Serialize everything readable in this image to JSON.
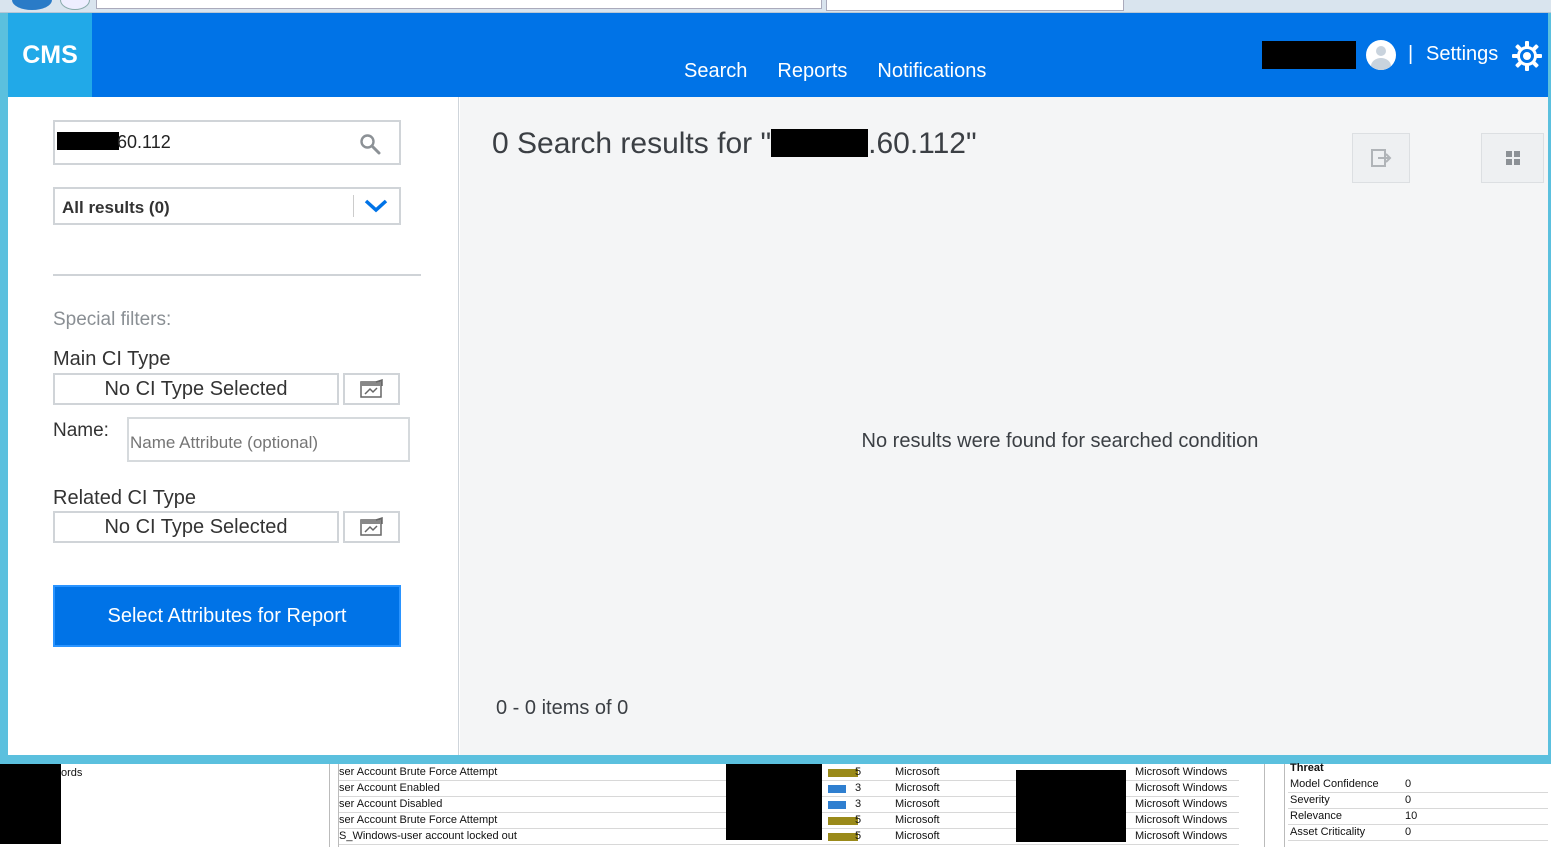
{
  "app": {
    "logo": "CMS"
  },
  "nav": {
    "search": "Search",
    "reports": "Reports",
    "notifications": "Notifications"
  },
  "header": {
    "separator": "|",
    "settings": "Settings"
  },
  "sidebar": {
    "search_value": "60.112",
    "scope": "All results (0)",
    "special_filters": "Special filters:",
    "main_ci_label": "Main CI Type",
    "main_ci_value": "No CI Type Selected",
    "name_label": "Name:",
    "name_placeholder": "Name Attribute (optional)",
    "related_ci_label": "Related CI Type",
    "related_ci_value": "No CI Type Selected",
    "report_button": "Select Attributes for Report"
  },
  "main": {
    "results_prefix": "0 Search results for \"",
    "results_suffix": ".60.112\"",
    "no_results": "No results were found for searched condition",
    "pager": "0 - 0 items of 0"
  },
  "background_window": {
    "left_text": "ords",
    "rows": [
      {
        "name": "ser Account Brute Force Attempt",
        "count": "5",
        "vendor": "Microsoft",
        "product": "Microsoft Windows",
        "color": "#9a8a1a"
      },
      {
        "name": "ser Account Enabled",
        "count": "3",
        "vendor": "Microsoft",
        "product": "Microsoft Windows",
        "color": "#2f7fd0"
      },
      {
        "name": "ser Account Disabled",
        "count": "3",
        "vendor": "Microsoft",
        "product": "Microsoft Windows",
        "color": "#2f7fd0"
      },
      {
        "name": "ser Account Brute Force Attempt",
        "count": "5",
        "vendor": "Microsoft",
        "product": "Microsoft Windows",
        "color": "#9a8a1a"
      },
      {
        "name": "S_Windows-user account locked out",
        "count": "5",
        "vendor": "Microsoft",
        "product": "Microsoft Windows",
        "color": "#9a8a1a"
      }
    ],
    "props_header": "Threat",
    "props": [
      {
        "key": "Model Confidence",
        "value": "0"
      },
      {
        "key": "Severity",
        "value": "0"
      },
      {
        "key": "Relevance",
        "value": "10"
      },
      {
        "key": "Asset Criticality",
        "value": "0"
      }
    ]
  }
}
